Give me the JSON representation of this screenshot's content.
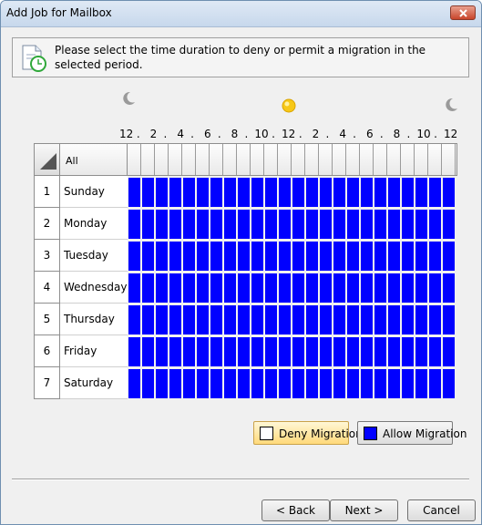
{
  "window": {
    "title": "Add Job for Mailbox"
  },
  "banner": {
    "text": "Please select the time duration to deny or permit a migration in the selected period.",
    "icon": "clock-document-icon"
  },
  "timeline": {
    "icons": [
      "moon-icon",
      "sun-icon",
      "moon-icon"
    ],
    "hour_labels": [
      "12",
      ".",
      "2",
      ".",
      "4",
      ".",
      "6",
      ".",
      "8",
      ".",
      "10",
      ".",
      "12",
      ".",
      "2",
      ".",
      "4",
      ".",
      "6",
      ".",
      "8",
      ".",
      "10",
      ".",
      "12"
    ]
  },
  "grid": {
    "all_label": "All",
    "days": [
      {
        "num": "1",
        "name": "Sunday"
      },
      {
        "num": "2",
        "name": "Monday"
      },
      {
        "num": "3",
        "name": "Tuesday"
      },
      {
        "num": "4",
        "name": "Wednesday"
      },
      {
        "num": "5",
        "name": "Thursday"
      },
      {
        "num": "6",
        "name": "Friday"
      },
      {
        "num": "7",
        "name": "Saturday"
      }
    ],
    "hours_per_day": 24,
    "state": "allow",
    "allow_color": "#0000ff",
    "deny_color": "#ffffff"
  },
  "legend": {
    "deny_label": "Deny Migration",
    "allow_label": "Allow Migration"
  },
  "buttons": {
    "back_label": "< Back",
    "next_label": "Next >",
    "cancel_label": "Cancel"
  }
}
